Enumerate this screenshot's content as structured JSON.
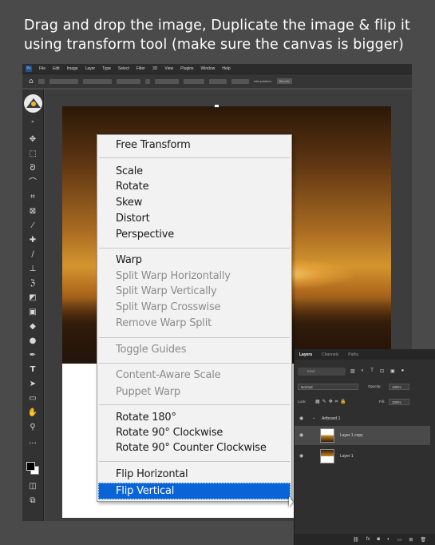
{
  "headline": "Drag and drop the image, Duplicate the image & flip it using transform tool (make sure the canvas is bigger)",
  "menubar": {
    "logo": "Ps",
    "items": [
      "File",
      "Edit",
      "Image",
      "Layer",
      "Type",
      "Select",
      "Filter",
      "3D",
      "View",
      "Plugins",
      "Window",
      "Help"
    ]
  },
  "optionsbar": {
    "home_icon": "home-icon",
    "interpolation_label": "Interpolation:",
    "interpolation_value": "Bicubic"
  },
  "toolbar": {
    "tools": [
      "move-icon",
      "marquee-icon",
      "lasso-icon",
      "quick-select-icon",
      "crop-icon",
      "frame-icon",
      "eyedropper-icon",
      "healing-icon",
      "brush-icon",
      "stamp-icon",
      "history-brush-icon",
      "eraser-icon",
      "gradient-icon",
      "blur-icon",
      "dodge-icon",
      "pen-icon",
      "type-icon",
      "path-select-icon",
      "rectangle-icon",
      "hand-icon",
      "zoom-icon",
      "more-icon"
    ]
  },
  "context_menu": {
    "groups": [
      {
        "items": [
          {
            "label": "Free Transform",
            "disabled": false
          }
        ]
      },
      {
        "items": [
          {
            "label": "Scale",
            "disabled": false
          },
          {
            "label": "Rotate",
            "disabled": false
          },
          {
            "label": "Skew",
            "disabled": false
          },
          {
            "label": "Distort",
            "disabled": false
          },
          {
            "label": "Perspective",
            "disabled": false
          }
        ]
      },
      {
        "items": [
          {
            "label": "Warp",
            "disabled": false
          },
          {
            "label": "Split Warp Horizontally",
            "disabled": true
          },
          {
            "label": "Split Warp Vertically",
            "disabled": true
          },
          {
            "label": "Split Warp Crosswise",
            "disabled": true
          },
          {
            "label": "Remove Warp Split",
            "disabled": true
          }
        ]
      },
      {
        "items": [
          {
            "label": "Toggle Guides",
            "disabled": true
          }
        ]
      },
      {
        "items": [
          {
            "label": "Content-Aware Scale",
            "disabled": true
          },
          {
            "label": "Puppet Warp",
            "disabled": true
          }
        ]
      },
      {
        "items": [
          {
            "label": "Rotate 180°",
            "disabled": false
          },
          {
            "label": "Rotate 90° Clockwise",
            "disabled": false
          },
          {
            "label": "Rotate 90° Counter Clockwise",
            "disabled": false
          }
        ]
      },
      {
        "items": [
          {
            "label": "Flip Horizontal",
            "disabled": false
          },
          {
            "label": "Flip Vertical",
            "disabled": false,
            "selected": true
          }
        ]
      }
    ]
  },
  "layers_panel": {
    "tabs": [
      "Layers",
      "Channels",
      "Paths"
    ],
    "active_tab": "Layers",
    "kind_placeholder": "Kind",
    "blend_mode": "Normal",
    "opacity_label": "Opacity:",
    "opacity_value": "100%",
    "lock_label": "Lock:",
    "fill_label": "Fill:",
    "fill_value": "100%",
    "artboard_name": "Artboard 1",
    "layers": [
      {
        "name": "Layer 1 copy",
        "flipped": true
      },
      {
        "name": "Layer 1",
        "flipped": false
      }
    ],
    "bottom_icons": [
      "link-icon",
      "fx-icon",
      "mask-icon",
      "adjustment-icon",
      "group-icon",
      "new-layer-icon",
      "trash-icon"
    ]
  }
}
